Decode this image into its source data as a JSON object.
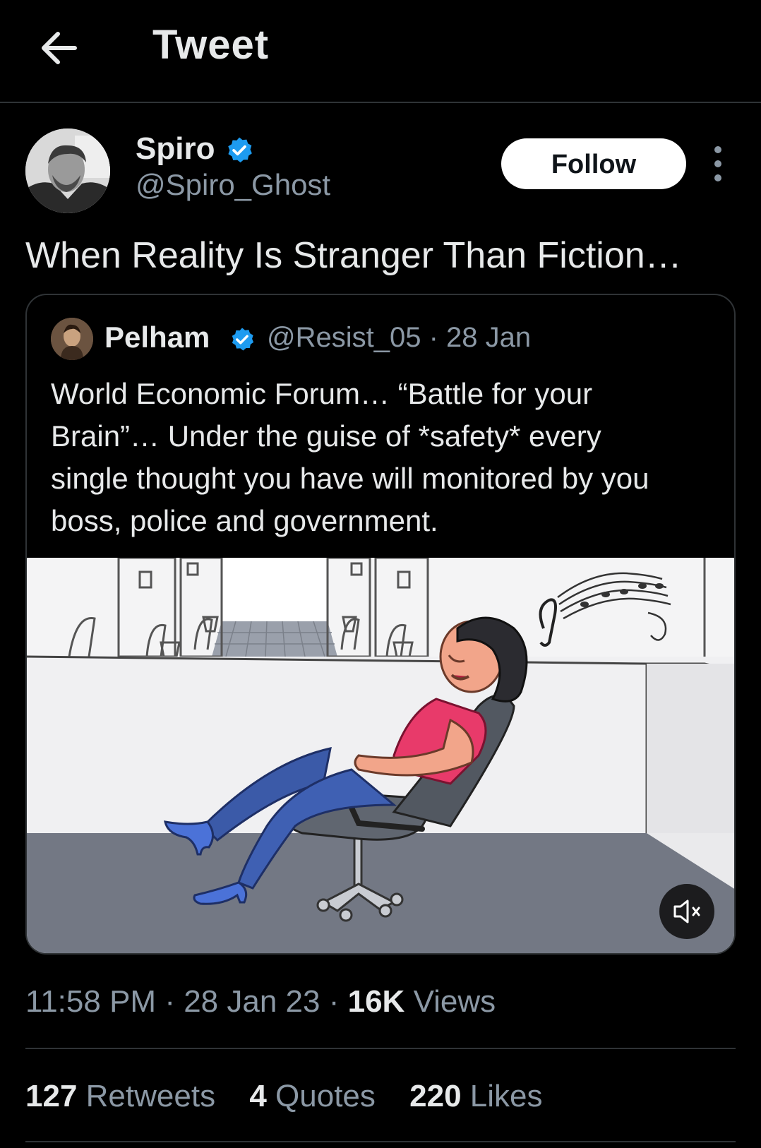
{
  "header": {
    "title": "Tweet",
    "back_icon": "arrow-left-icon"
  },
  "author": {
    "display_name": "Spiro",
    "handle": "@Spiro_Ghost",
    "verified": true,
    "follow_label": "Follow",
    "more_icon": "more-vertical-icon"
  },
  "tweet": {
    "text": "When Reality Is Stranger Than Fiction…"
  },
  "quote": {
    "display_name": "Pelham",
    "verified": true,
    "handle_date": "@Resist_05 · 28 Jan",
    "text": "World Economic Forum… “Battle for your Brain”… Under the guise of *safety* every single thought you have will monitored by you boss, police and government.",
    "media": {
      "kind": "video",
      "mute_icon": "speaker-muted-icon"
    }
  },
  "meta": {
    "time": "11:58 PM",
    "date": "28 Jan 23",
    "views_count": "16K",
    "views_label": "Views"
  },
  "stats": [
    {
      "count": "127",
      "label": "Retweets"
    },
    {
      "count": "4",
      "label": "Quotes"
    },
    {
      "count": "220",
      "label": "Likes"
    }
  ],
  "colors": {
    "background": "#000000",
    "text_primary": "#e7e9ea",
    "text_secondary": "#8b98a5",
    "verified_blue": "#1d9bf0",
    "divider": "#2f3336"
  }
}
